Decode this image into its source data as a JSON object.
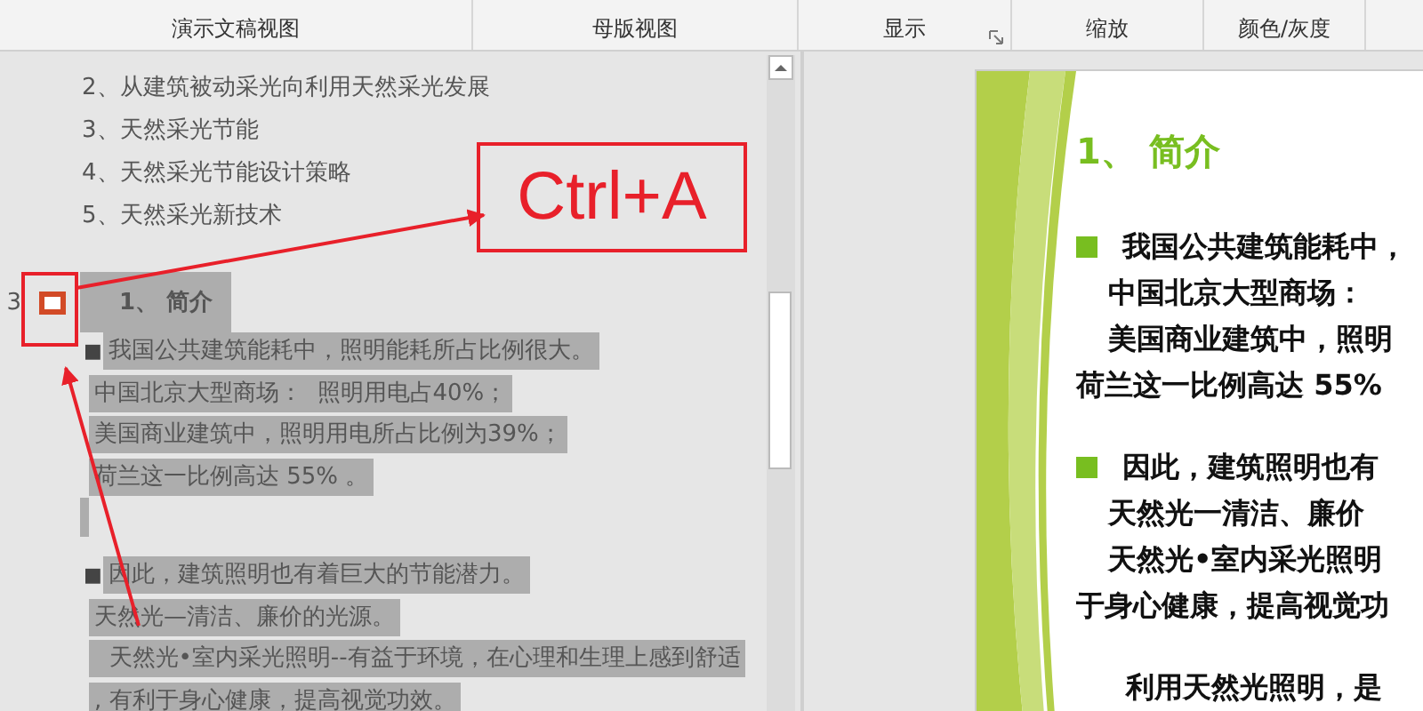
{
  "ribbon": {
    "groups": [
      {
        "label": "演示文稿视图",
        "launcher": false
      },
      {
        "label": "母版视图",
        "launcher": false
      },
      {
        "label": "显示",
        "launcher": true
      },
      {
        "label": "缩放",
        "launcher": false
      },
      {
        "label": "颜色/灰度",
        "launcher": false
      }
    ]
  },
  "outline": {
    "items": [
      "2、从建筑被动采光向利用天然采光发展",
      "3、天然采光节能",
      "4、天然采光节能设计策略",
      "5、天然采光新技术"
    ],
    "slide": {
      "number": "3",
      "title": "1、 简介",
      "selected": true,
      "paragraphs": [
        {
          "bullet": "■",
          "lines": [
            "我国公共建筑能耗中，照明能耗所占比例很大。",
            "中国北京大型商场：  照明用电占40%；",
            "美国商业建筑中，照明用电所占比例为39%；",
            "荷兰这一比例高达 55% 。"
          ]
        },
        {
          "bullet": "■",
          "lines": [
            "因此，建筑照明也有着巨大的节能潜力。",
            "天然光—清洁、廉价的光源。",
            "  天然光•室内采光照明--有益于环境，在心理和生理上感到舒适",
            ", 有利于身心健康，提高视觉功效。"
          ]
        }
      ]
    }
  },
  "annotation": {
    "shortcut": "Ctrl+A"
  },
  "slide_view": {
    "title": "1、 简介",
    "paragraphs": [
      {
        "bullet": true,
        "lines": [
          "我国公共建筑能耗中，",
          "中国北京大型商场：",
          "美国商业建筑中，照明",
          "荷兰这一比例高达 55%"
        ]
      },
      {
        "bullet": true,
        "lines": [
          "因此，建筑照明也有",
          "天然光一清洁、廉价",
          "天然光•室内采光照明",
          "于身心健康，提高视觉功"
        ]
      },
      {
        "bullet": false,
        "lines": [
          "利用天然光照明，是"
        ]
      }
    ]
  }
}
